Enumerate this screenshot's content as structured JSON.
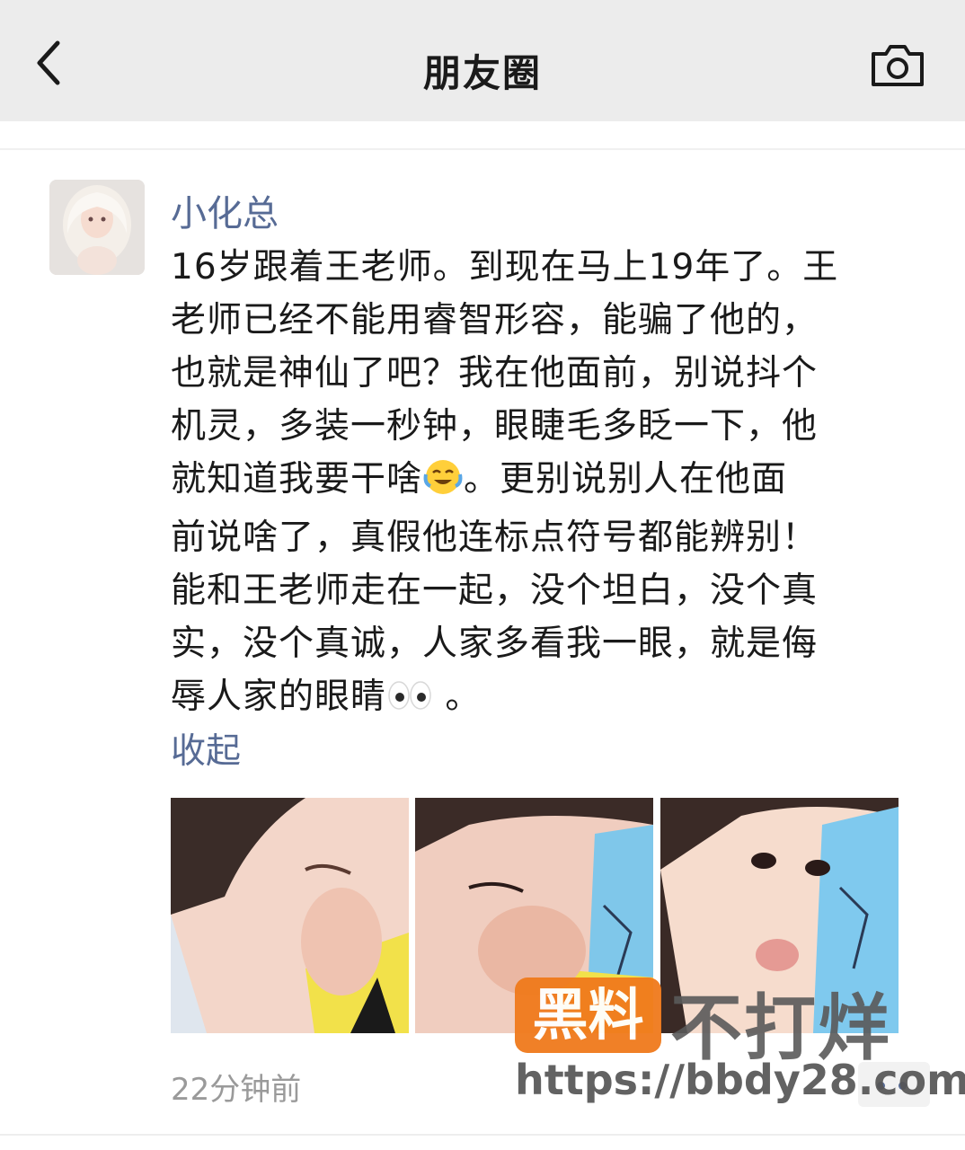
{
  "header": {
    "title": "朋友圈",
    "back_icon": "chevron-left-icon",
    "camera_icon": "camera-icon"
  },
  "post": {
    "author": "小化总",
    "lines": [
      "16岁跟着王老师。到现在马上19年了。王",
      "老师已经不能用睿智形容，能骗了他的，",
      "也就是神仙了吧？我在他面前，别说抖个",
      "机灵，多装一秒钟，眼睫毛多眨一下，他",
      "就知道我要干啥",
      "。更别说别人在他面",
      "前说啥了，真假他连标点符号都能辨别！",
      "能和王老师走在一起，没个坦白，没个真",
      "实，没个真诚，人家多看我一眼，就是侮",
      "辱人家的眼睛",
      " 。"
    ],
    "collapse_label": "收起",
    "time": "22分钟前"
  },
  "watermark": {
    "badge": "黑料",
    "text": "不打烊",
    "url": "https://bbdy28.com"
  },
  "colors": {
    "link": "#576b95",
    "header_bg": "#ececec",
    "badge": "#f07a1c"
  }
}
